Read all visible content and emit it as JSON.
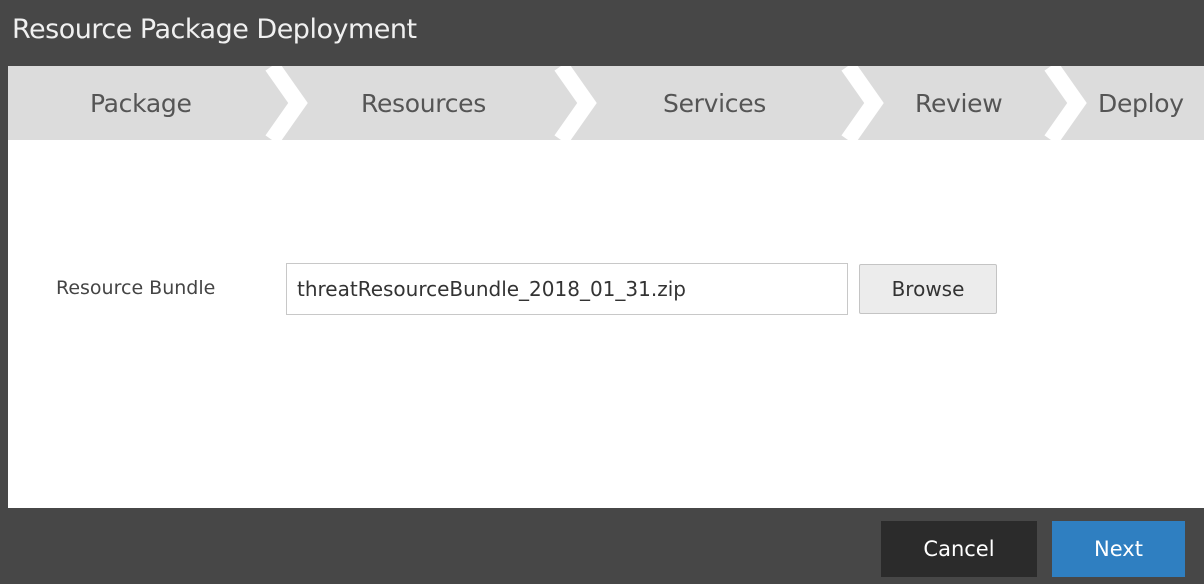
{
  "dialog": {
    "title": "Resource Package Deployment"
  },
  "wizard": {
    "steps": [
      {
        "label": "Package"
      },
      {
        "label": "Resources"
      },
      {
        "label": "Services"
      },
      {
        "label": "Review"
      },
      {
        "label": "Deploy"
      }
    ],
    "active_step": "Package"
  },
  "form": {
    "resource_bundle_label": "Resource Bundle",
    "resource_bundle_value": "threatResourceBundle_2018_01_31.zip",
    "browse_label": "Browse"
  },
  "footer": {
    "cancel_label": "Cancel",
    "next_label": "Next"
  },
  "colors": {
    "chrome": "#474747",
    "wizard_bar": "#dcdcdc",
    "primary": "#2f7fc1",
    "cancel": "#2b2b2b"
  }
}
